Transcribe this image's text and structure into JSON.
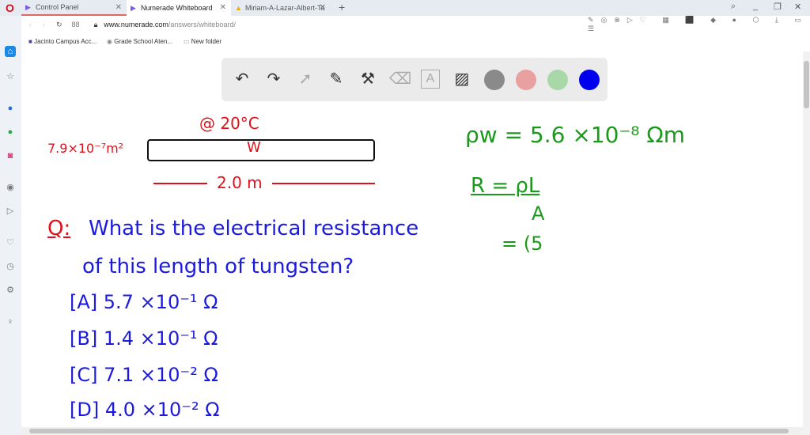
{
  "tabs": [
    {
      "label": "Control Panel"
    },
    {
      "label": "Numerade Whiteboard"
    },
    {
      "label": "Miriam-A-Lazar-Albert-Ta"
    }
  ],
  "address": {
    "host": "www.numerade.com",
    "path": "/answers/whiteboard/"
  },
  "bookmarks": [
    {
      "label": "Jacinto Campus Acc..."
    },
    {
      "label": "Grade School Aten..."
    },
    {
      "label": "New folder"
    }
  ],
  "toolbar": {
    "colors": [
      "#8a8a8a",
      "#e8a0a0",
      "#a8d8a8",
      "#0000ee"
    ]
  },
  "board": {
    "temp": "@  20°C",
    "area": "7.9×10⁻⁷m²",
    "wire_label": "W",
    "length": "2.0 m",
    "q_label": "Q:",
    "question1": "What is the electrical resistance",
    "question2": "of this length of tungsten?",
    "options": [
      "[A]  5.7 ×10⁻¹ Ω",
      "[B]  1.4 ×10⁻¹ Ω",
      "[C]  7.1 ×10⁻² Ω",
      "[D]  4.0 ×10⁻² Ω"
    ],
    "rho": "ρw = 5.6 ×10⁻⁸ Ωm",
    "r_eq": "R = ρL",
    "r_den": "A",
    "step": "= (5"
  }
}
